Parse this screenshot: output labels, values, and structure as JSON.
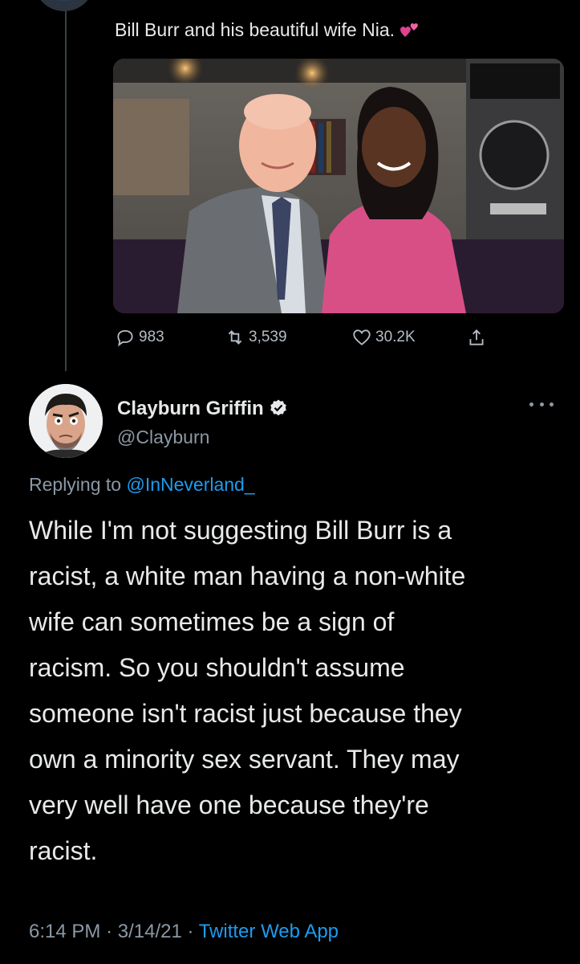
{
  "quoted_tweet": {
    "text": "Bill Burr and his beautiful wife Nia.",
    "emoji": "two-hearts-icon",
    "actions": {
      "replies": "983",
      "retweets": "3,539",
      "likes": "30.2K"
    }
  },
  "reply_tweet": {
    "display_name": "Clayburn Griffin",
    "handle": "@Clayburn",
    "replying_prefix": "Replying to",
    "replying_to": "@InNeverland_",
    "body": "While I'm not suggesting Bill Burr is a\nracist, a white man having a non-white\nwife can sometimes be a sign of\nracism.  So you shouldn't assume\nsomeone isn't racist just because they\nown a minority sex servant.   They may\nvery well have one because they're\nracist.",
    "time": "6:14 PM",
    "separator": "·",
    "date": "3/14/21",
    "source": "Twitter Web App"
  },
  "colors": {
    "background": "#000000",
    "text": "#e7e9ea",
    "secondary": "#8b98a5",
    "accent": "#1d9bf0"
  }
}
